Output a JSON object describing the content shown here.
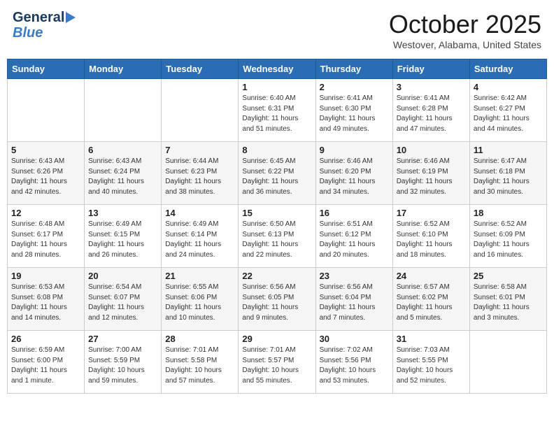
{
  "logo": {
    "line1": "General",
    "line2": "Blue"
  },
  "title": "October 2025",
  "location": "Westover, Alabama, United States",
  "days_of_week": [
    "Sunday",
    "Monday",
    "Tuesday",
    "Wednesday",
    "Thursday",
    "Friday",
    "Saturday"
  ],
  "weeks": [
    [
      {
        "day": "",
        "info": ""
      },
      {
        "day": "",
        "info": ""
      },
      {
        "day": "",
        "info": ""
      },
      {
        "day": "1",
        "info": "Sunrise: 6:40 AM\nSunset: 6:31 PM\nDaylight: 11 hours\nand 51 minutes."
      },
      {
        "day": "2",
        "info": "Sunrise: 6:41 AM\nSunset: 6:30 PM\nDaylight: 11 hours\nand 49 minutes."
      },
      {
        "day": "3",
        "info": "Sunrise: 6:41 AM\nSunset: 6:28 PM\nDaylight: 11 hours\nand 47 minutes."
      },
      {
        "day": "4",
        "info": "Sunrise: 6:42 AM\nSunset: 6:27 PM\nDaylight: 11 hours\nand 44 minutes."
      }
    ],
    [
      {
        "day": "5",
        "info": "Sunrise: 6:43 AM\nSunset: 6:26 PM\nDaylight: 11 hours\nand 42 minutes."
      },
      {
        "day": "6",
        "info": "Sunrise: 6:43 AM\nSunset: 6:24 PM\nDaylight: 11 hours\nand 40 minutes."
      },
      {
        "day": "7",
        "info": "Sunrise: 6:44 AM\nSunset: 6:23 PM\nDaylight: 11 hours\nand 38 minutes."
      },
      {
        "day": "8",
        "info": "Sunrise: 6:45 AM\nSunset: 6:22 PM\nDaylight: 11 hours\nand 36 minutes."
      },
      {
        "day": "9",
        "info": "Sunrise: 6:46 AM\nSunset: 6:20 PM\nDaylight: 11 hours\nand 34 minutes."
      },
      {
        "day": "10",
        "info": "Sunrise: 6:46 AM\nSunset: 6:19 PM\nDaylight: 11 hours\nand 32 minutes."
      },
      {
        "day": "11",
        "info": "Sunrise: 6:47 AM\nSunset: 6:18 PM\nDaylight: 11 hours\nand 30 minutes."
      }
    ],
    [
      {
        "day": "12",
        "info": "Sunrise: 6:48 AM\nSunset: 6:17 PM\nDaylight: 11 hours\nand 28 minutes."
      },
      {
        "day": "13",
        "info": "Sunrise: 6:49 AM\nSunset: 6:15 PM\nDaylight: 11 hours\nand 26 minutes."
      },
      {
        "day": "14",
        "info": "Sunrise: 6:49 AM\nSunset: 6:14 PM\nDaylight: 11 hours\nand 24 minutes."
      },
      {
        "day": "15",
        "info": "Sunrise: 6:50 AM\nSunset: 6:13 PM\nDaylight: 11 hours\nand 22 minutes."
      },
      {
        "day": "16",
        "info": "Sunrise: 6:51 AM\nSunset: 6:12 PM\nDaylight: 11 hours\nand 20 minutes."
      },
      {
        "day": "17",
        "info": "Sunrise: 6:52 AM\nSunset: 6:10 PM\nDaylight: 11 hours\nand 18 minutes."
      },
      {
        "day": "18",
        "info": "Sunrise: 6:52 AM\nSunset: 6:09 PM\nDaylight: 11 hours\nand 16 minutes."
      }
    ],
    [
      {
        "day": "19",
        "info": "Sunrise: 6:53 AM\nSunset: 6:08 PM\nDaylight: 11 hours\nand 14 minutes."
      },
      {
        "day": "20",
        "info": "Sunrise: 6:54 AM\nSunset: 6:07 PM\nDaylight: 11 hours\nand 12 minutes."
      },
      {
        "day": "21",
        "info": "Sunrise: 6:55 AM\nSunset: 6:06 PM\nDaylight: 11 hours\nand 10 minutes."
      },
      {
        "day": "22",
        "info": "Sunrise: 6:56 AM\nSunset: 6:05 PM\nDaylight: 11 hours\nand 9 minutes."
      },
      {
        "day": "23",
        "info": "Sunrise: 6:56 AM\nSunset: 6:04 PM\nDaylight: 11 hours\nand 7 minutes."
      },
      {
        "day": "24",
        "info": "Sunrise: 6:57 AM\nSunset: 6:02 PM\nDaylight: 11 hours\nand 5 minutes."
      },
      {
        "day": "25",
        "info": "Sunrise: 6:58 AM\nSunset: 6:01 PM\nDaylight: 11 hours\nand 3 minutes."
      }
    ],
    [
      {
        "day": "26",
        "info": "Sunrise: 6:59 AM\nSunset: 6:00 PM\nDaylight: 11 hours\nand 1 minute."
      },
      {
        "day": "27",
        "info": "Sunrise: 7:00 AM\nSunset: 5:59 PM\nDaylight: 10 hours\nand 59 minutes."
      },
      {
        "day": "28",
        "info": "Sunrise: 7:01 AM\nSunset: 5:58 PM\nDaylight: 10 hours\nand 57 minutes."
      },
      {
        "day": "29",
        "info": "Sunrise: 7:01 AM\nSunset: 5:57 PM\nDaylight: 10 hours\nand 55 minutes."
      },
      {
        "day": "30",
        "info": "Sunrise: 7:02 AM\nSunset: 5:56 PM\nDaylight: 10 hours\nand 53 minutes."
      },
      {
        "day": "31",
        "info": "Sunrise: 7:03 AM\nSunset: 5:55 PM\nDaylight: 10 hours\nand 52 minutes."
      },
      {
        "day": "",
        "info": ""
      }
    ]
  ]
}
